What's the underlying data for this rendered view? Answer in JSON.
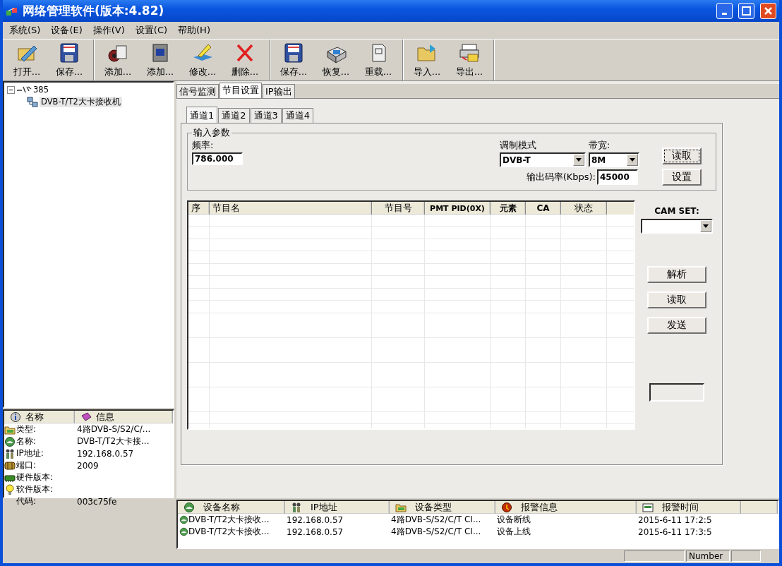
{
  "window": {
    "title": "网络管理软件(版本:4.82)"
  },
  "menu": [
    {
      "label": "系统(S)"
    },
    {
      "label": "设备(E)"
    },
    {
      "label": "操作(V)"
    },
    {
      "label": "设置(C)"
    },
    {
      "label": "帮助(H)"
    }
  ],
  "toolbar": [
    [
      {
        "label": "打开..."
      },
      {
        "label": "保存..."
      }
    ],
    [
      {
        "label": "添加..."
      },
      {
        "label": "添加..."
      },
      {
        "label": "修改..."
      },
      {
        "label": "删除..."
      }
    ],
    [
      {
        "label": "保存..."
      },
      {
        "label": "恢复..."
      },
      {
        "label": "重载..."
      }
    ],
    [
      {
        "label": "导入..."
      },
      {
        "label": "导出..."
      }
    ]
  ],
  "tree": {
    "label": "385",
    "expanded": true,
    "children": [
      {
        "label": "DVB-T/T2大卡接收机",
        "selected": true
      }
    ]
  },
  "info": {
    "columns": [
      "名称",
      "信息"
    ],
    "rows": [
      {
        "name": "类型:",
        "value": "4路DVB-S/S2/C/..."
      },
      {
        "name": "名称:",
        "value": "DVB-T/T2大卡接..."
      },
      {
        "name": "IP地址:",
        "value": "192.168.0.57"
      },
      {
        "name": "端口:",
        "value": "2009"
      },
      {
        "name": "硬件版本:"
      },
      {
        "name": "软件版本:"
      },
      {
        "name": "代码:",
        "value": "003c75fe"
      }
    ]
  },
  "main_tabs": [
    {
      "label": "信号监测",
      "selected": false
    },
    {
      "label": "节目设置",
      "selected": true
    },
    {
      "label": "IP输出",
      "selected": false
    }
  ],
  "channel_tabs": [
    {
      "label": "通道1",
      "selected": true
    },
    {
      "label": "通道2",
      "selected": false
    },
    {
      "label": "通道3",
      "selected": false
    },
    {
      "label": "通道4",
      "selected": false
    }
  ],
  "input_params": {
    "title": "输入参数",
    "frequency": {
      "label": "频率:",
      "value": "786.000"
    },
    "modulation": {
      "label": "调制模式",
      "value": "DVB-T"
    },
    "bandwidth": {
      "label": "带宽:",
      "value": "8M"
    },
    "bitrate": {
      "label": "输出码率(Kbps):",
      "value": "45000"
    },
    "buttons": [
      {
        "label": "读取",
        "focused": true
      },
      {
        "label": "设置",
        "focused": false
      }
    ]
  },
  "programs": {
    "columns": [
      "序",
      "节目名",
      "节目号",
      "PMT PID(0X)",
      "元素",
      "CA",
      "状态"
    ]
  },
  "cam_set": {
    "label": "CAM SET:"
  },
  "side_buttons": [
    "解析",
    "读取",
    "发送"
  ],
  "alarms": {
    "columns": [
      "设备名称",
      "IP地址",
      "设备类型",
      "报警信息",
      "报警时间"
    ],
    "rows": [
      [
        "DVB-T/T2大卡接收...",
        "192.168.0.57",
        "4路DVB-S/S2/C/T CI...",
        "设备断线",
        "2015-6-11 17:2:5"
      ],
      [
        "DVB-T/T2大卡接收...",
        "192.168.0.57",
        "4路DVB-S/S2/C/T CI...",
        "设备上线",
        "2015-6-11 17:3:5"
      ]
    ]
  },
  "status_bar": {
    "number_panel": "Number"
  }
}
